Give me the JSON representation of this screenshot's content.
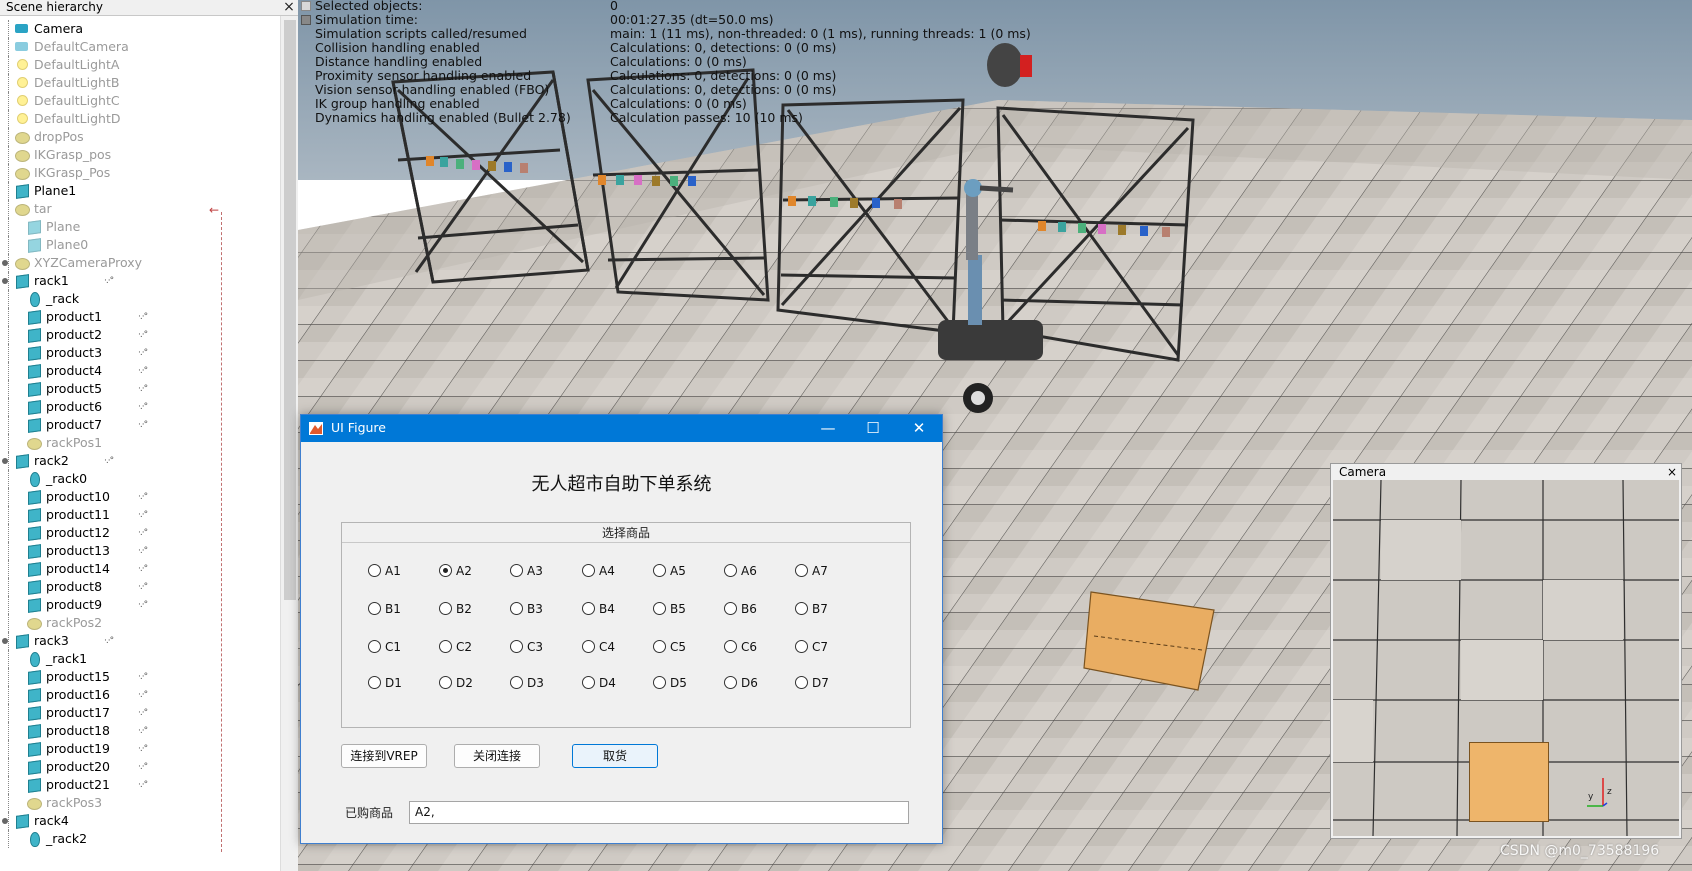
{
  "hierarchy": {
    "title": "Scene hierarchy",
    "close": "×",
    "items": [
      {
        "label": "Camera",
        "icon": "camera-icon"
      },
      {
        "label": "DefaultCamera",
        "icon": "camera-icon"
      },
      {
        "label": "DefaultLightA",
        "icon": "light-icon"
      },
      {
        "label": "DefaultLightB",
        "icon": "light-icon"
      },
      {
        "label": "DefaultLightC",
        "icon": "light-icon"
      },
      {
        "label": "DefaultLightD",
        "icon": "light-icon"
      },
      {
        "label": "dropPos",
        "icon": "dummy-icon"
      },
      {
        "label": "IKGrasp_pos",
        "icon": "dummy-icon"
      },
      {
        "label": "IKGrasp_Pos",
        "icon": "dummy-icon"
      },
      {
        "label": "Plane1",
        "icon": "shape-icon"
      },
      {
        "label": "tar",
        "icon": "dummy-icon"
      },
      {
        "label": "Plane",
        "icon": "shape-icon"
      },
      {
        "label": "Plane0",
        "icon": "shape-icon"
      },
      {
        "label": "XYZCameraProxy",
        "icon": "dummy-icon"
      },
      {
        "label": "rack1",
        "icon": "shape-icon"
      },
      {
        "label": "_rack",
        "icon": "drop-shape-icon"
      },
      {
        "label": "product1",
        "icon": "shape-icon"
      },
      {
        "label": "product2",
        "icon": "shape-icon"
      },
      {
        "label": "product3",
        "icon": "shape-icon"
      },
      {
        "label": "product4",
        "icon": "shape-icon"
      },
      {
        "label": "product5",
        "icon": "shape-icon"
      },
      {
        "label": "product6",
        "icon": "shape-icon"
      },
      {
        "label": "product7",
        "icon": "shape-icon"
      },
      {
        "label": "rackPos1",
        "icon": "dummy-icon"
      },
      {
        "label": "rack2",
        "icon": "shape-icon"
      },
      {
        "label": "_rack0",
        "icon": "drop-shape-icon"
      },
      {
        "label": "product10",
        "icon": "shape-icon"
      },
      {
        "label": "product11",
        "icon": "shape-icon"
      },
      {
        "label": "product12",
        "icon": "shape-icon"
      },
      {
        "label": "product13",
        "icon": "shape-icon"
      },
      {
        "label": "product14",
        "icon": "shape-icon"
      },
      {
        "label": "product8",
        "icon": "shape-icon"
      },
      {
        "label": "product9",
        "icon": "shape-icon"
      },
      {
        "label": "rackPos2",
        "icon": "dummy-icon"
      },
      {
        "label": "rack3",
        "icon": "shape-icon"
      },
      {
        "label": "_rack1",
        "icon": "drop-shape-icon"
      },
      {
        "label": "product15",
        "icon": "shape-icon"
      },
      {
        "label": "product16",
        "icon": "shape-icon"
      },
      {
        "label": "product17",
        "icon": "shape-icon"
      },
      {
        "label": "product18",
        "icon": "shape-icon"
      },
      {
        "label": "product19",
        "icon": "shape-icon"
      },
      {
        "label": "product20",
        "icon": "shape-icon"
      },
      {
        "label": "product21",
        "icon": "shape-icon"
      },
      {
        "label": "rackPos3",
        "icon": "dummy-icon"
      },
      {
        "label": "rack4",
        "icon": "shape-icon"
      },
      {
        "label": "_rack2",
        "icon": "drop-shape-icon"
      }
    ]
  },
  "sim_info": {
    "labels": [
      "Selected objects:",
      "Simulation time:",
      "Simulation scripts called/resumed",
      "Collision handling enabled",
      "Distance handling enabled",
      "Proximity sensor handling enabled",
      "Vision sensor handling enabled (FBO)",
      "IK group handling enabled",
      "Dynamics handling enabled (Bullet 2.78)"
    ],
    "values": [
      "0",
      "00:01:27.35 (dt=50.0 ms)",
      "main: 1 (11 ms), non-threaded: 0 (1 ms), running threads: 1 (0 ms)",
      "Calculations: 0, detections: 0 (0 ms)",
      "Calculations: 0 (0 ms)",
      "Calculations: 0, detections: 0 (0 ms)",
      "Calculations: 0, detections: 0 (0 ms)",
      "Calculations: 0 (0 ms)",
      "Calculation passes: 10 (10 ms)"
    ]
  },
  "camera_window": {
    "title": "Camera",
    "close": "×",
    "axis_y": "y",
    "axis_z": "z"
  },
  "watermark": "CSDN @m0_73588196",
  "figure": {
    "title": "UI Figure",
    "minimize": "—",
    "maximize": "☐",
    "close": "✕",
    "heading": "无人超市自助下单系统",
    "group_title": "选择商品",
    "options": [
      [
        "A1",
        "A2",
        "A3",
        "A4",
        "A5",
        "A6",
        "A7"
      ],
      [
        "B1",
        "B2",
        "B3",
        "B4",
        "B5",
        "B6",
        "B7"
      ],
      [
        "C1",
        "C2",
        "C3",
        "C4",
        "C5",
        "C6",
        "C7"
      ],
      [
        "D1",
        "D2",
        "D3",
        "D4",
        "D5",
        "D6",
        "D7"
      ]
    ],
    "selected": "A2",
    "buttons": {
      "connect": "连接到VREP",
      "disconnect": "关闭连接",
      "pickup": "取货"
    },
    "purchased_label": "已购商品",
    "purchased_value": "A2,"
  },
  "colors": {
    "titlebar": "#0078d7",
    "floor_tile": "#cbc6c0",
    "sky": "#7d93a6",
    "box": "#eeb56b"
  }
}
